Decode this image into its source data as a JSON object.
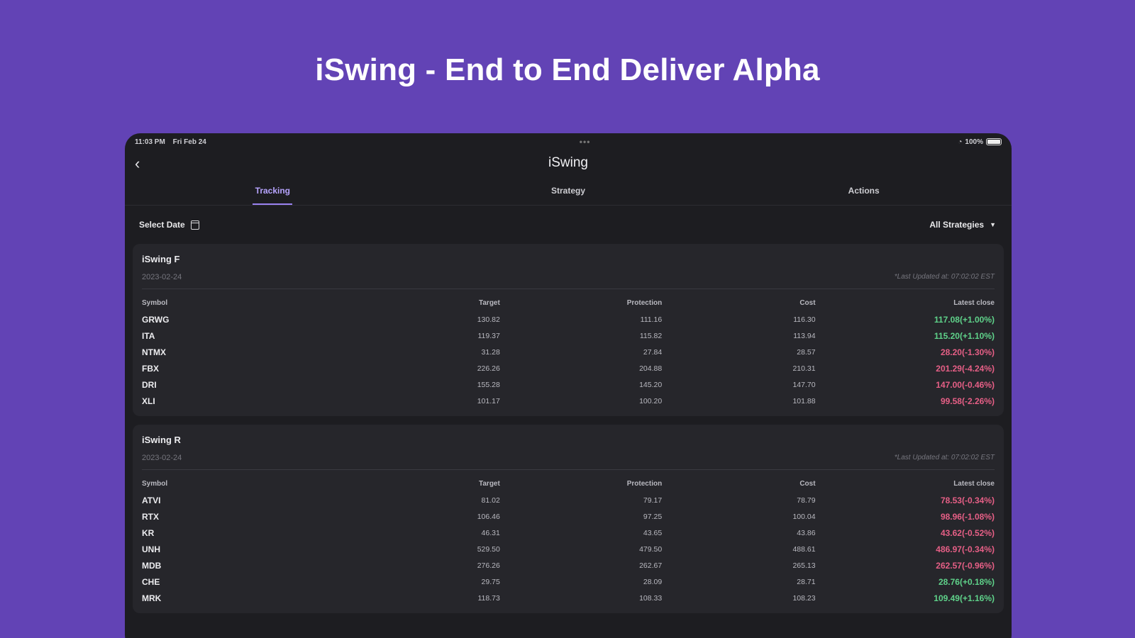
{
  "headline": "iSwing - End to End Deliver Alpha",
  "status_bar": {
    "time": "11:03 PM",
    "date": "Fri Feb 24",
    "battery": "100%"
  },
  "nav": {
    "title": "iSwing"
  },
  "tabs": [
    {
      "label": "Tracking",
      "active": true
    },
    {
      "label": "Strategy",
      "active": false
    },
    {
      "label": "Actions",
      "active": false
    }
  ],
  "filters": {
    "select_date": "Select Date",
    "strategy": "All Strategies"
  },
  "colors": {
    "background": "#6243b5",
    "accent": "#9a82f0",
    "positive": "#5fd28a",
    "negative": "#e65f86"
  },
  "columns": [
    "Symbol",
    "Target",
    "Protection",
    "Cost",
    "Latest close"
  ],
  "cards": [
    {
      "title": "iSwing F",
      "date": "2023-02-24",
      "updated": "*Last Updated at: 07:02:02 EST",
      "rows": [
        {
          "symbol": "GRWG",
          "target": "130.82",
          "protection": "111.16",
          "cost": "116.30",
          "close": "117.08(+1.00%)",
          "trend": "up"
        },
        {
          "symbol": "ITA",
          "target": "119.37",
          "protection": "115.82",
          "cost": "113.94",
          "close": "115.20(+1.10%)",
          "trend": "up"
        },
        {
          "symbol": "NTMX",
          "target": "31.28",
          "protection": "27.84",
          "cost": "28.57",
          "close": "28.20(-1.30%)",
          "trend": "down"
        },
        {
          "symbol": "FBX",
          "target": "226.26",
          "protection": "204.88",
          "cost": "210.31",
          "close": "201.29(-4.24%)",
          "trend": "down"
        },
        {
          "symbol": "DRI",
          "target": "155.28",
          "protection": "145.20",
          "cost": "147.70",
          "close": "147.00(-0.46%)",
          "trend": "down"
        },
        {
          "symbol": "XLI",
          "target": "101.17",
          "protection": "100.20",
          "cost": "101.88",
          "close": "99.58(-2.26%)",
          "trend": "down"
        }
      ]
    },
    {
      "title": "iSwing R",
      "date": "2023-02-24",
      "updated": "*Last Updated at: 07:02:02 EST",
      "rows": [
        {
          "symbol": "ATVI",
          "target": "81.02",
          "protection": "79.17",
          "cost": "78.79",
          "close": "78.53(-0.34%)",
          "trend": "down"
        },
        {
          "symbol": "RTX",
          "target": "106.46",
          "protection": "97.25",
          "cost": "100.04",
          "close": "98.96(-1.08%)",
          "trend": "down"
        },
        {
          "symbol": "KR",
          "target": "46.31",
          "protection": "43.65",
          "cost": "43.86",
          "close": "43.62(-0.52%)",
          "trend": "down"
        },
        {
          "symbol": "UNH",
          "target": "529.50",
          "protection": "479.50",
          "cost": "488.61",
          "close": "486.97(-0.34%)",
          "trend": "down"
        },
        {
          "symbol": "MDB",
          "target": "276.26",
          "protection": "262.67",
          "cost": "265.13",
          "close": "262.57(-0.96%)",
          "trend": "down"
        },
        {
          "symbol": "CHE",
          "target": "29.75",
          "protection": "28.09",
          "cost": "28.71",
          "close": "28.76(+0.18%)",
          "trend": "up"
        },
        {
          "symbol": "MRK",
          "target": "118.73",
          "protection": "108.33",
          "cost": "108.23",
          "close": "109.49(+1.16%)",
          "trend": "up"
        }
      ]
    }
  ]
}
